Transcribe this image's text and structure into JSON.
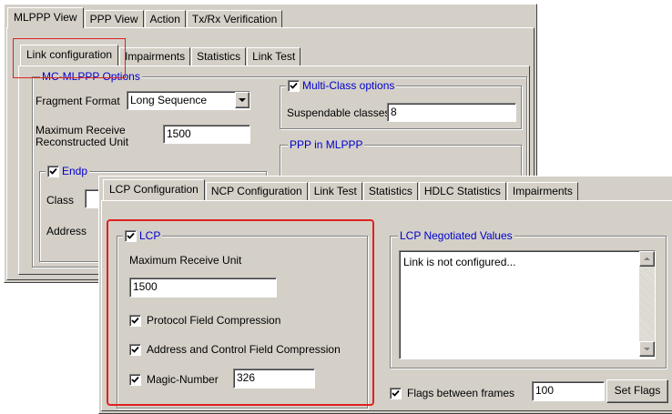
{
  "back_window": {
    "top_tabs": [
      "MLPPP View",
      "PPP View",
      "Action",
      "Tx/Rx Verification"
    ],
    "sub_tabs": [
      "Link configuration",
      "Impairments",
      "Statistics",
      "Link Test"
    ],
    "mc_mlppp_group": "MC-MLPPP Options",
    "fragment_format_label": "Fragment Format",
    "fragment_format_value": "Long Sequence",
    "mrru_label_line1": "Maximum Receive",
    "mrru_label_line2": "Reconstructed Unit",
    "mrru_value": "1500",
    "multiclass_group": "Multi-Class options",
    "suspendable_label": "Suspendable classes",
    "suspendable_value": "8",
    "ppp_in_mlppp_group": "PPP in MLPPP",
    "endpoint_partial": "Endp",
    "class_label": "Class",
    "address_label": "Address"
  },
  "front_window": {
    "tabs": [
      "LCP Configuration",
      "NCP Configuration",
      "Link Test",
      "Statistics",
      "HDLC Statistics",
      "Impairments"
    ],
    "lcp_group": "LCP",
    "mru_label": "Maximum Receive Unit",
    "mru_value": "1500",
    "pfc_label": "Protocol Field Compression",
    "acfc_label": "Address and Control Field Compression",
    "magic_label": "Magic-Number",
    "magic_value": "326",
    "negotiated_group": "LCP Negotiated Values",
    "negotiated_text": "Link is not configured...",
    "flags_label": "Flags between frames",
    "flags_value": "100",
    "set_flags_button": "Set Flags"
  },
  "colors": {
    "dialog_bg": "#d4d0c8",
    "group_title": "#0000cc",
    "highlight": "#e02020"
  }
}
